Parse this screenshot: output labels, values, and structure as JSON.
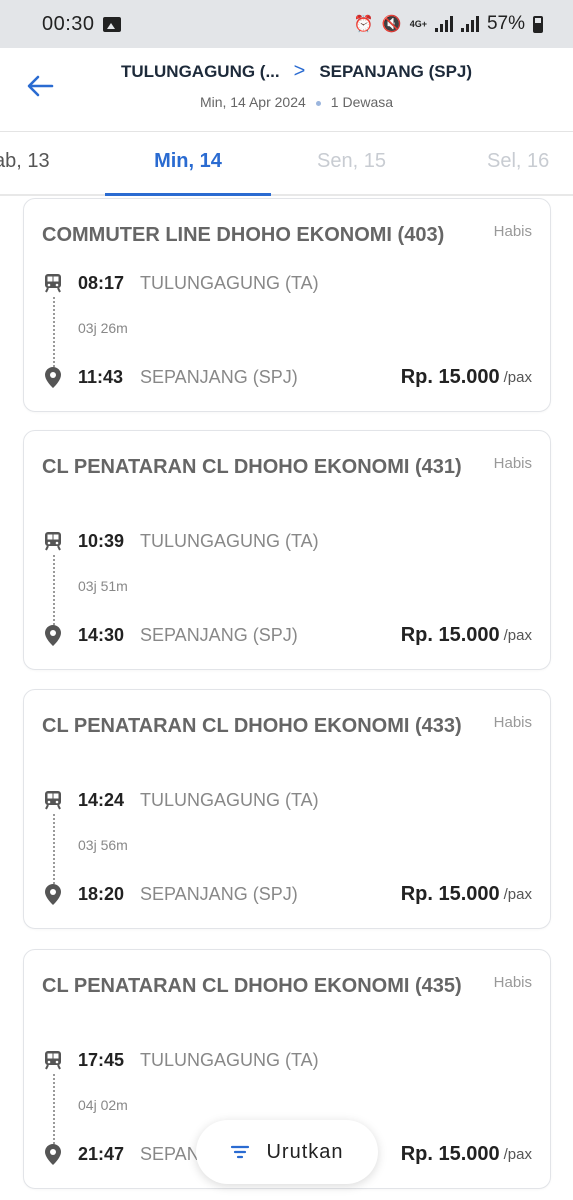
{
  "status_bar": {
    "time": "00:30",
    "battery": "57%",
    "network": "4G+"
  },
  "header": {
    "origin": "TULUNGAGUNG (...",
    "destination": "SEPANJANG (SPJ)",
    "date": "Min, 14 Apr 2024",
    "passengers": "1 Dewasa"
  },
  "date_tabs": [
    {
      "label": "ab, 13"
    },
    {
      "label": "Min, 14",
      "active": true
    },
    {
      "label": "Sen, 15"
    },
    {
      "label": "Sel, 16"
    }
  ],
  "trains": [
    {
      "name": "COMMUTER LINE DHOHO EKONOMI (403)",
      "status": "Habis",
      "depart_time": "08:17",
      "depart_station": "TULUNGAGUNG (TA)",
      "duration": "03j 26m",
      "arrive_time": "11:43",
      "arrive_station": "SEPANJANG (SPJ)",
      "price": "Rp. 15.000",
      "unit": "/pax"
    },
    {
      "name": "CL PENATARAN CL DHOHO EKONOMI (431)",
      "status": "Habis",
      "depart_time": "10:39",
      "depart_station": "TULUNGAGUNG (TA)",
      "duration": "03j 51m",
      "arrive_time": "14:30",
      "arrive_station": "SEPANJANG (SPJ)",
      "price": "Rp. 15.000",
      "unit": "/pax"
    },
    {
      "name": "CL PENATARAN CL DHOHO EKONOMI (433)",
      "status": "Habis",
      "depart_time": "14:24",
      "depart_station": "TULUNGAGUNG (TA)",
      "duration": "03j 56m",
      "arrive_time": "18:20",
      "arrive_station": "SEPANJANG (SPJ)",
      "price": "Rp. 15.000",
      "unit": "/pax"
    },
    {
      "name": "CL PENATARAN CL DHOHO EKONOMI (435)",
      "status": "Habis",
      "depart_time": "17:45",
      "depart_station": "TULUNGAGUNG (TA)",
      "duration": "04j 02m",
      "arrive_time": "21:47",
      "arrive_station": "SEPAN",
      "price": "Rp. 15.000",
      "unit": "/pax"
    }
  ],
  "sort_button": {
    "label": "Urutkan"
  },
  "colors": {
    "accent": "#2a6bd1",
    "muted": "#888888",
    "card_border": "#e2e4e8"
  }
}
